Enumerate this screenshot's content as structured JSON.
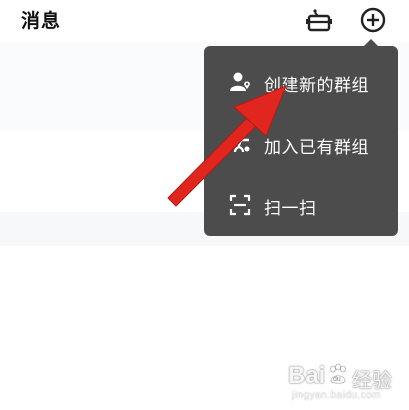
{
  "header": {
    "title": "消息",
    "robot_icon": "robot-icon",
    "add_icon": "add-circle-icon"
  },
  "menu": {
    "items": [
      {
        "label": "创建新的群组",
        "icon": "create-group-icon"
      },
      {
        "label": "加入已有群组",
        "icon": "join-group-icon"
      },
      {
        "label": "扫一扫",
        "icon": "scan-icon"
      }
    ]
  },
  "annotation": {
    "arrow_color": "#e0261e"
  },
  "watermark": {
    "brand": "Bai",
    "paw": "du",
    "suffix": "经验",
    "domain": "jingyan.baidu.com"
  },
  "colors": {
    "menu_bg": "#4c4c4c",
    "menu_text": "#ffffff",
    "title_text": "#111111"
  }
}
